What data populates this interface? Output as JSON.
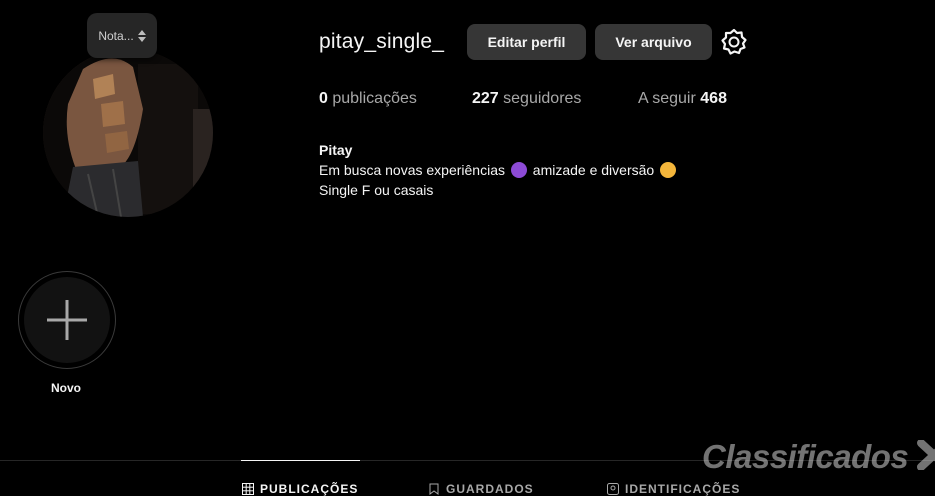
{
  "note": {
    "text": "Nota..."
  },
  "profile": {
    "username": "pitay_single_",
    "edit_label": "Editar perfil",
    "archive_label": "Ver arquivo"
  },
  "stats": {
    "posts_count": "0",
    "posts_label": "publicações",
    "followers_count": "227",
    "followers_label": "seguidores",
    "following_label": "A seguir",
    "following_count": "468"
  },
  "bio": {
    "name": "Pitay",
    "line1_a": "Em busca novas experiências",
    "line1_b": "amizade e diversão",
    "line2": "Single F ou casais"
  },
  "highlight": {
    "label": "Novo"
  },
  "tabs": [
    {
      "label": "PUBLICAÇÕES",
      "icon": "grid-icon",
      "active": true
    },
    {
      "label": "GUARDADOS",
      "icon": "bookmark-icon",
      "active": false
    },
    {
      "label": "IDENTIFICAÇÕES",
      "icon": "tag-icon",
      "active": false
    }
  ],
  "watermark": {
    "text": "Classificados"
  },
  "colors": {
    "background": "#000000",
    "button": "#363636",
    "muted": "#a8a8a8"
  }
}
